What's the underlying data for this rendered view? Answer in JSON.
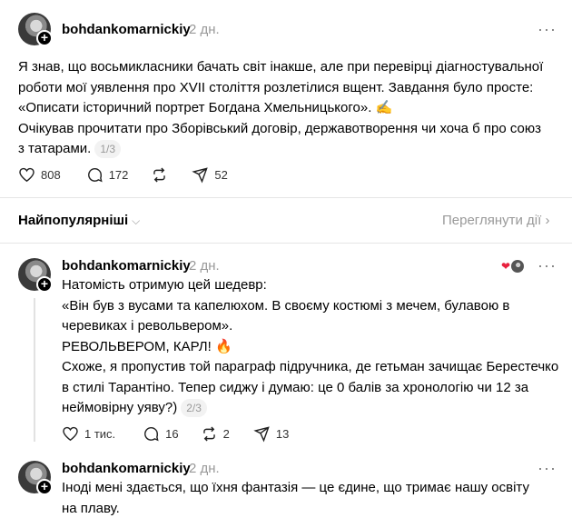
{
  "post": {
    "username": "bohdankomarnickiy",
    "time": "2 дн.",
    "more": "···",
    "lines": [
      "Я знав, що восьмикласники бачать світ інакше, але при перевірці діагностувальної",
      "роботи мої уявлення про XVII століття розлетілися вщент. Завдання було просте:",
      "«Описати історичний портрет Богдана Хмельницького». ✍️",
      "Очікував прочитати про Зборівський договір, державотворення чи хоча б про союз",
      "з татарами."
    ],
    "pager": "1/3",
    "likes": "808",
    "comments": "172",
    "shares": "52"
  },
  "sort": {
    "label": "Найпопулярніші",
    "chevron": "⌵",
    "activity": "Переглянути дії",
    "activity_arrow": "›"
  },
  "reply1": {
    "username": "bohdankomarnickiy",
    "time": "2 дн.",
    "more": "···",
    "lines": [
      "Натомість отримую цей шедевр:",
      "«Він був з вусами та капелюхом. В своєму костюмі з мечем, булавою в",
      "черевиках і револьвером».",
      "РЕВОЛЬВЕРОМ, КАРЛ! 🔥",
      "Схоже, я пропустив той параграф підручника, де гетьман зачищає Берестечко",
      "в стилі Тарантіно. Тепер сиджу і думаю: це 0 балів за хронологію чи 12 за",
      "неймовірну уяву?)"
    ],
    "pager": "2/3",
    "likes": "1 тис.",
    "comments": "16",
    "reposts": "2",
    "shares": "13"
  },
  "reply2": {
    "username": "bohdankomarnickiy",
    "time": "2 дн.",
    "more": "···",
    "lines": [
      "Іноді мені здається, що їхня фантазія — це єдине, що тримає нашу освіту",
      "на плаву."
    ]
  }
}
